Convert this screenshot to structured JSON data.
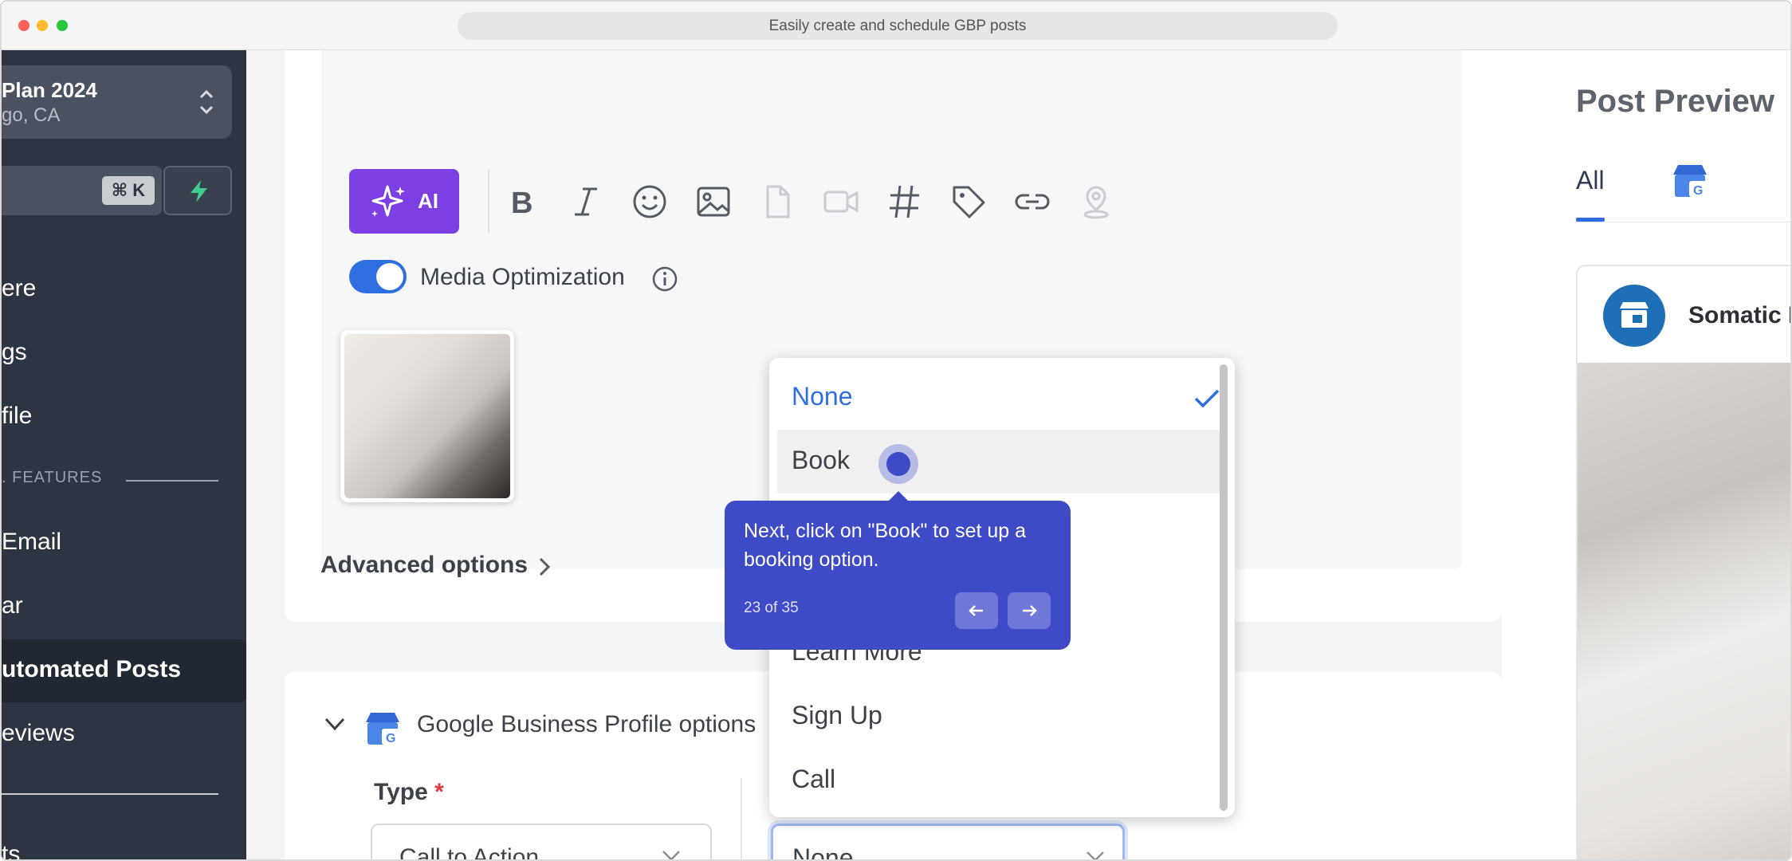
{
  "window": {
    "url_title": "Easily create and schedule GBP posts"
  },
  "sidebar": {
    "plan_title": "Plan 2024",
    "plan_subtitle": "go, CA",
    "shortcut": "⌘ K",
    "items": [
      {
        "label": "ere"
      },
      {
        "label": "gs"
      },
      {
        "label": "file"
      },
      {
        "label": " Email"
      },
      {
        "label": "ar"
      },
      {
        "label": "utomated Posts"
      },
      {
        "label": "eviews"
      },
      {
        "label": "ts"
      }
    ],
    "section_label": ". FEATURES"
  },
  "editor": {
    "ai_label": "AI",
    "media_optimization_label": "Media Optimization",
    "advanced_options_label": "Advanced options"
  },
  "gbp": {
    "title": "Google Business Profile options",
    "type_label": "Type",
    "required_mark": "*",
    "type_value": "Call to Action",
    "button_value": "None"
  },
  "dropdown": {
    "options": [
      "None",
      "Book",
      "Learn More",
      "Sign Up",
      "Call"
    ],
    "selected": "None"
  },
  "tooltip": {
    "text": "Next, click on \"Book\" to set up a booking option.",
    "step": "23 of 35"
  },
  "preview": {
    "title": "Post Preview",
    "tab_all": "All",
    "business_name": "Somatic I"
  },
  "colors": {
    "sidebar_bg": "#2e3542",
    "ai_purple": "#7b3fe4",
    "accent_blue": "#2f6ee0",
    "tooltip_bg": "#3f4ac6"
  }
}
